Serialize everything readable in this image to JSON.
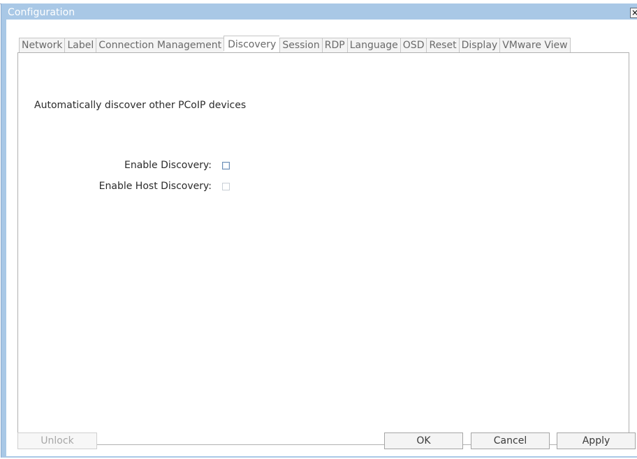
{
  "window": {
    "title": "Configuration",
    "close_glyph": "×"
  },
  "tabs": [
    {
      "label": "Network",
      "active": false
    },
    {
      "label": "Label",
      "active": false
    },
    {
      "label": "Connection Management",
      "active": false
    },
    {
      "label": "Discovery",
      "active": true
    },
    {
      "label": "Session",
      "active": false
    },
    {
      "label": "RDP",
      "active": false
    },
    {
      "label": "Language",
      "active": false
    },
    {
      "label": "OSD",
      "active": false
    },
    {
      "label": "Reset",
      "active": false
    },
    {
      "label": "Display",
      "active": false
    },
    {
      "label": "VMware View",
      "active": false
    }
  ],
  "discovery": {
    "description": "Automatically discover other PCoIP devices",
    "enable_discovery_label": "Enable Discovery:",
    "enable_discovery_checked": false,
    "enable_host_discovery_label": "Enable Host Discovery:",
    "enable_host_discovery_checked": false,
    "enable_host_discovery_disabled": true
  },
  "buttons": {
    "unlock": "Unlock",
    "ok": "OK",
    "cancel": "Cancel",
    "apply": "Apply"
  },
  "colors": {
    "titlebar": "#a9c8e6",
    "title_text": "#ffffff"
  }
}
